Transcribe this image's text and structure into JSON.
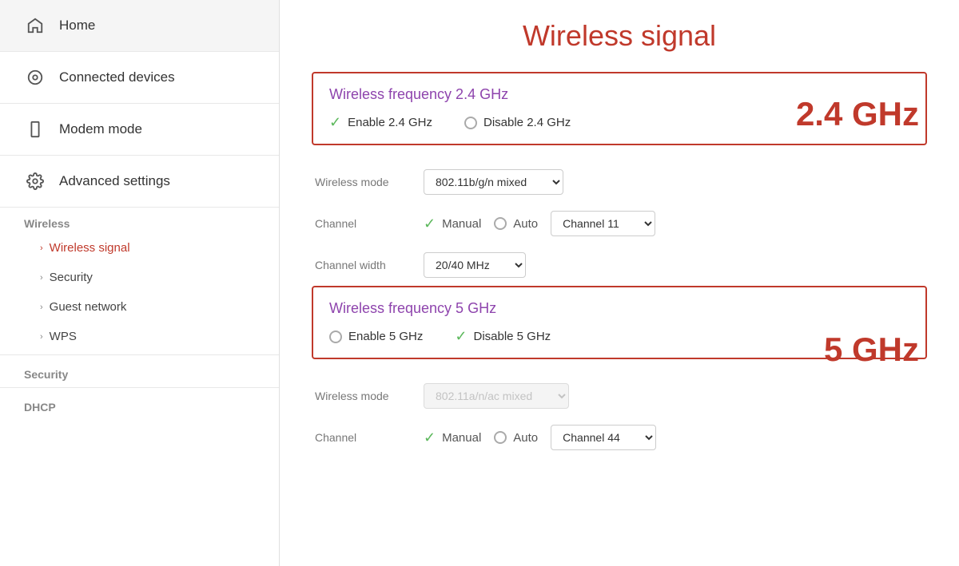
{
  "sidebar": {
    "items": [
      {
        "id": "home",
        "label": "Home",
        "icon": "home"
      },
      {
        "id": "connected-devices",
        "label": "Connected devices",
        "icon": "devices"
      },
      {
        "id": "modem-mode",
        "label": "Modem mode",
        "icon": "modem"
      },
      {
        "id": "advanced-settings",
        "label": "Advanced settings",
        "icon": "settings"
      }
    ],
    "sections": [
      {
        "id": "wireless",
        "label": "Wireless",
        "sub_items": [
          {
            "id": "wireless-signal",
            "label": "Wireless signal",
            "active": true
          },
          {
            "id": "security",
            "label": "Security",
            "active": false
          },
          {
            "id": "guest-network",
            "label": "Guest network",
            "active": false
          },
          {
            "id": "wps",
            "label": "WPS",
            "active": false
          }
        ]
      }
    ],
    "bottom_sections": [
      "Security",
      "DHCP"
    ]
  },
  "main": {
    "page_title": "Wireless signal",
    "annotation_24": "2.4 GHz",
    "annotation_5": "5 GHz",
    "freq_24": {
      "title": "Wireless frequency 2.4 GHz",
      "enable_label": "Enable 2.4 GHz",
      "disable_label": "Disable 2.4 GHz",
      "enable_checked": true,
      "disable_checked": false
    },
    "settings_24": {
      "mode_label": "Wireless mode",
      "mode_value": "802.11b/g/n mixed",
      "channel_label": "Channel",
      "channel_manual_label": "Manual",
      "channel_auto_label": "Auto",
      "channel_value": "Channel 11",
      "width_label": "Channel width",
      "width_value": "20/40 MHz"
    },
    "freq_5": {
      "title": "Wireless frequency 5 GHz",
      "enable_label": "Enable 5 GHz",
      "disable_label": "Disable 5 GHz",
      "enable_checked": false,
      "disable_checked": true
    },
    "settings_5": {
      "mode_label": "Wireless mode",
      "mode_value": "802.11a/n/ac mixed",
      "channel_label": "Channel",
      "channel_manual_label": "Manual",
      "channel_auto_label": "Auto",
      "channel_value": "Channel 44"
    }
  }
}
